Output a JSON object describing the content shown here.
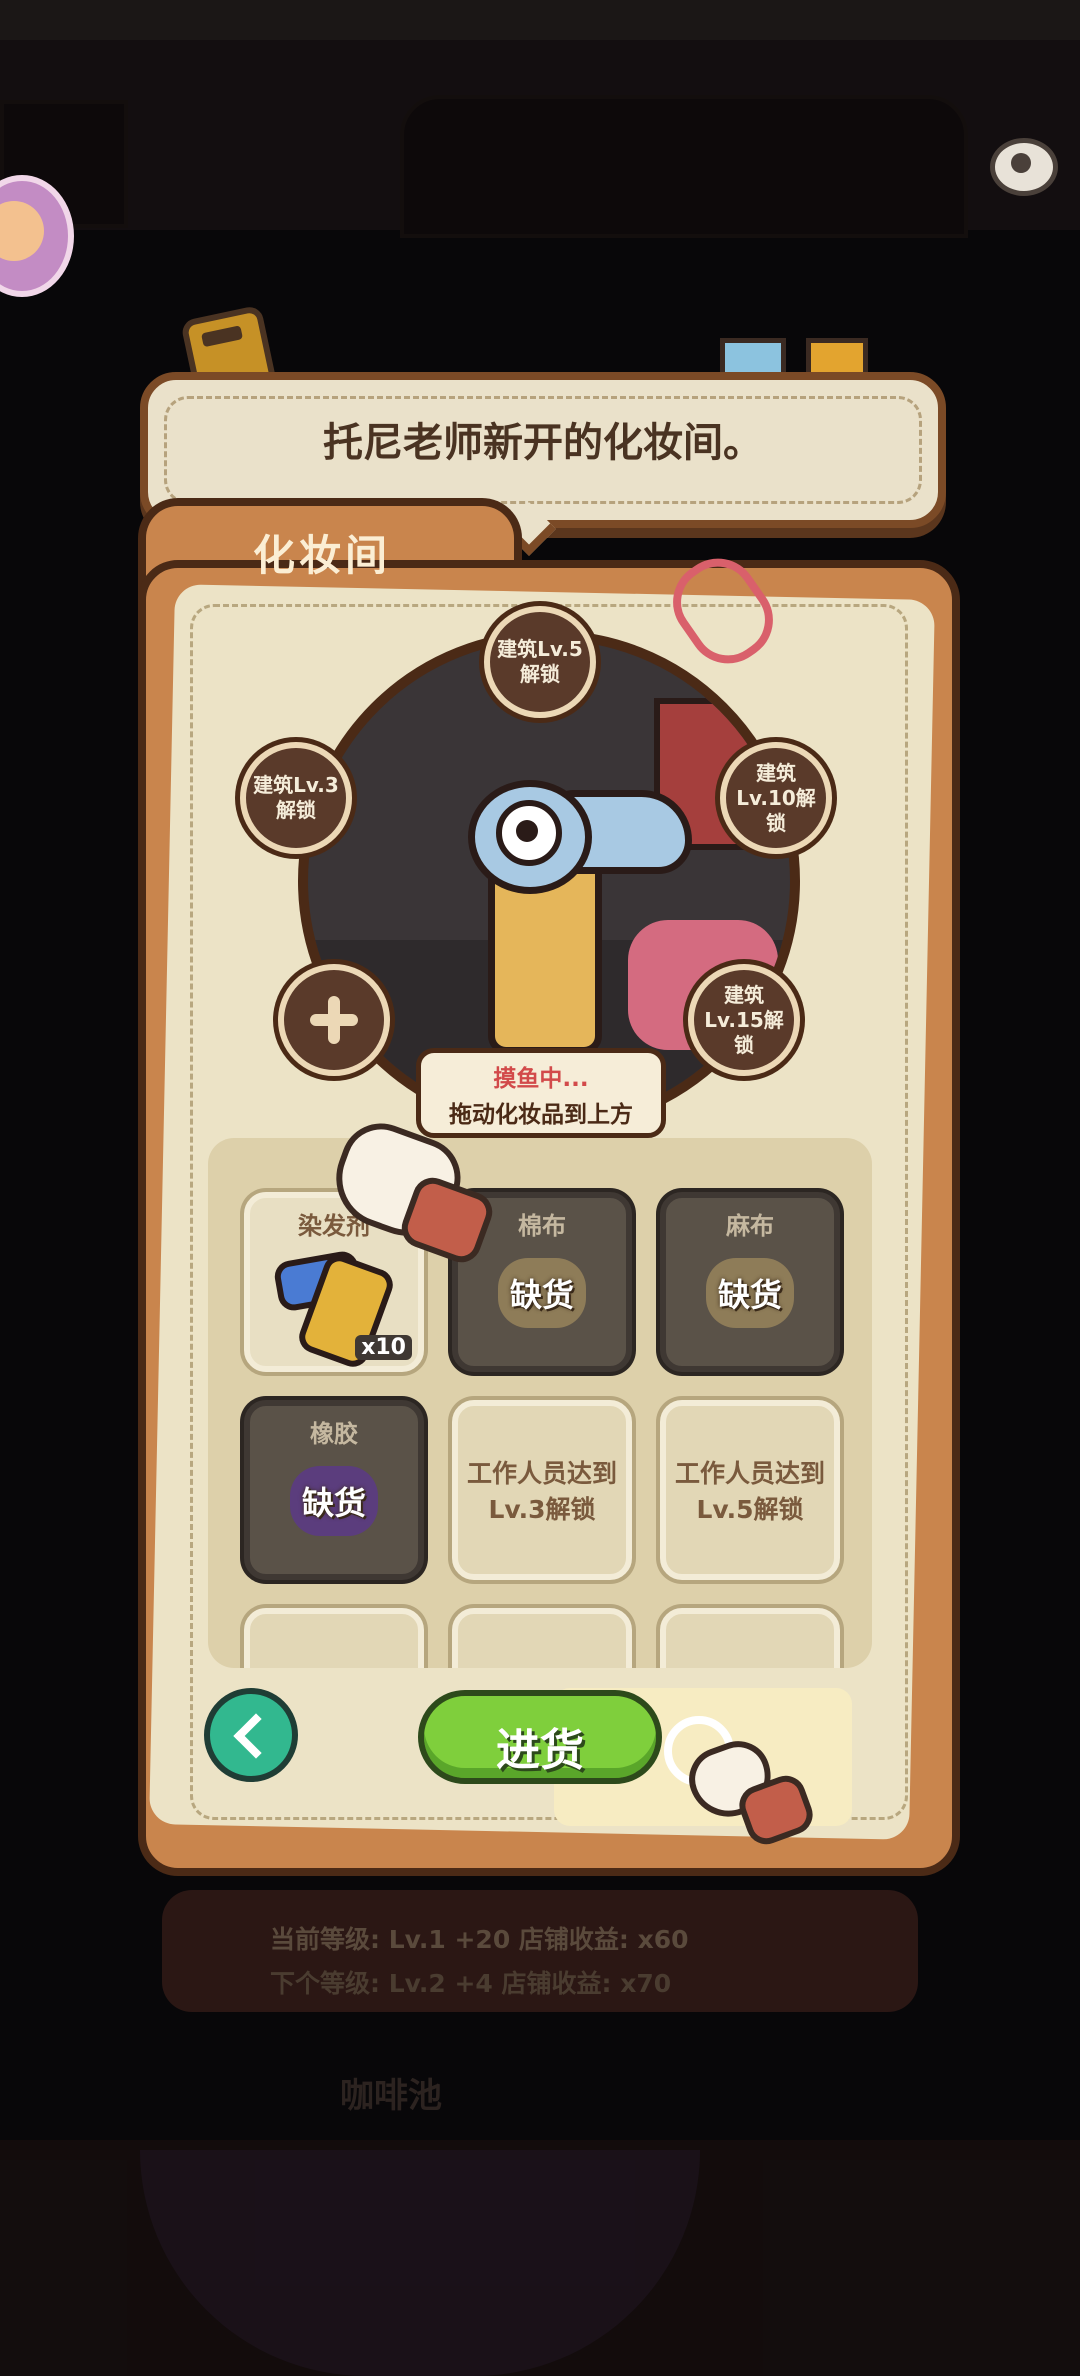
{
  "dialog": {
    "message": "托尼老师新开的化妆间。",
    "tab_title": "化妆间"
  },
  "mirror": {
    "slots": [
      {
        "label": "建筑Lv.5解锁"
      },
      {
        "label": "建筑Lv.3解锁"
      },
      {
        "label": "建筑Lv.10解锁"
      },
      {
        "label": "建筑Lv.15解锁"
      }
    ],
    "status_line1": "摸鱼中...",
    "status_line2": "拖动化妆品到上方"
  },
  "items": [
    {
      "name": "染发剂",
      "count": "x10"
    },
    {
      "name": "棉布",
      "state": "缺货"
    },
    {
      "name": "麻布",
      "state": "缺货"
    },
    {
      "name": "橡胶",
      "state": "缺货"
    },
    {
      "lock": "工作人员达到Lv.3解锁"
    },
    {
      "lock": "工作人员达到Lv.5解锁"
    }
  ],
  "buttons": {
    "restock": "进货"
  },
  "footer": {
    "line1": "当前等级: Lv.1  +20  店铺收益:  x60",
    "line2": "下个等级: Lv.2  +4  店铺收益:  x70",
    "line3": "咖啡池"
  },
  "colors": {
    "panel": "#c9854d",
    "paper": "#ece3c6",
    "restock_green": "#7fcf3c",
    "back_teal": "#32b88f",
    "status_red": "#d24a4a"
  }
}
